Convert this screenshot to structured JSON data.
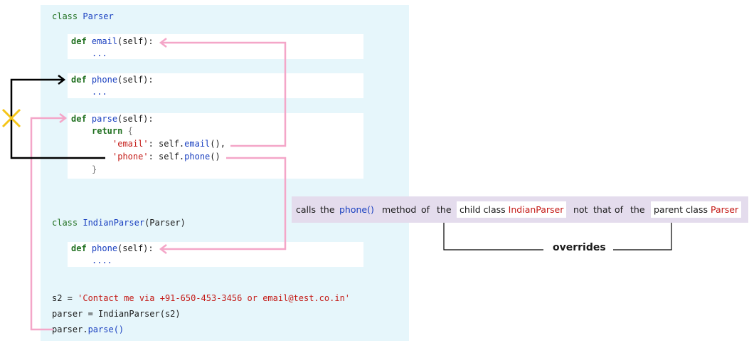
{
  "code": {
    "class_parser": {
      "kw": "class",
      "name": "Parser"
    },
    "email_def": {
      "kw": "def",
      "name": "email",
      "args": "(self):",
      "body": "..."
    },
    "phone_def": {
      "kw": "def",
      "name": "phone",
      "args": "(self):",
      "body": "..."
    },
    "parse_def": {
      "kw": "def",
      "name": "parse",
      "args": "(self):"
    },
    "return_line": {
      "kw": "return",
      "brace_open": "{"
    },
    "email_entry": {
      "key": "'email'",
      "colon": ": self.",
      "method": "email",
      "tail": "(),"
    },
    "phone_entry": {
      "key": "'phone'",
      "colon": ": self.",
      "method": "phone",
      "tail": "()"
    },
    "brace_close": "}",
    "class_indian": {
      "kw": "class",
      "name": "IndianParser",
      "base": "(Parser)"
    },
    "indian_phone_def": {
      "kw": "def",
      "name": "phone",
      "args": "(self):",
      "body": "...."
    },
    "s2_line": {
      "lhs": "s2 = ",
      "value": "'Contact me via +91-650-453-3456 or email@test.co.in'"
    },
    "parser_line": {
      "text": "parser = IndianParser(s2)"
    },
    "call_line": {
      "obj": "parser.",
      "method": "parse()"
    }
  },
  "note": {
    "w1": "calls",
    "w2": "the",
    "w3": "phone()",
    "w4": "method",
    "w5": "of",
    "w6": "the",
    "chip1_a": "child class",
    "chip1_b": "IndianParser",
    "w7": "not",
    "w8": "that",
    "w9": "of",
    "w10": "the",
    "chip2_a": "parent class",
    "chip2_b": "Parser"
  },
  "overrides_label": "overrides",
  "colors": {
    "pink_arrow": "#f4a6c8",
    "black_arrow": "#000000",
    "cross": "#f5c518",
    "panel": "#e6f6fb",
    "note": "#e4dced"
  }
}
